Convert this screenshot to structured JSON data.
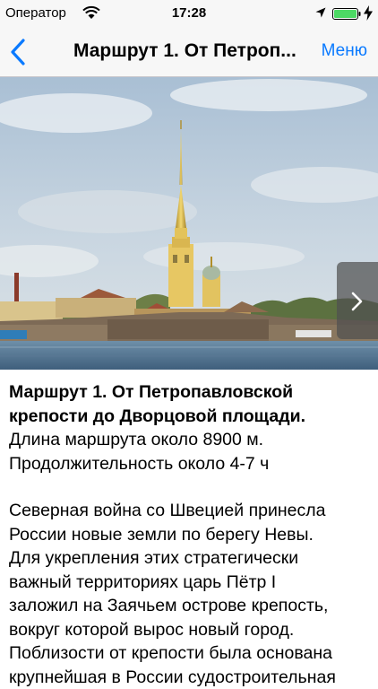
{
  "status_bar": {
    "carrier": "Оператор",
    "time": "17:28",
    "icons": [
      "wifi-icon",
      "location-arrow-icon",
      "battery-icon",
      "charging-bolt-icon"
    ],
    "battery_color": "#4cd964"
  },
  "nav": {
    "title": "Маршрут 1. От Петроп...",
    "menu_label": "Меню",
    "accent_color": "#0a7aff",
    "back_icon": "chevron-left-icon"
  },
  "hero": {
    "image": "Peter and Paul Fortress viewed across the Neva river",
    "next_icon": "chevron-right-icon"
  },
  "content": {
    "heading_lines": [
      "Маршрут 1.  От Петропавловской",
      "крепости до Дворцовой площади."
    ],
    "info_lines": [
      "Длина маршрута около 8900 м.",
      "Продолжительность около 4-7 ч"
    ],
    "body_lines": [
      "Северная война со Швецией принесла",
      "России новые земли по берегу Невы.",
      "Для укрепления этих стратегически",
      "важный территориях царь Пётр I",
      "заложил на Заячьем острове крепость,",
      "вокруг которой вырос новый город.",
      "Поблизости от крепости была основана",
      "крупнейшая в России судостроительная"
    ]
  }
}
